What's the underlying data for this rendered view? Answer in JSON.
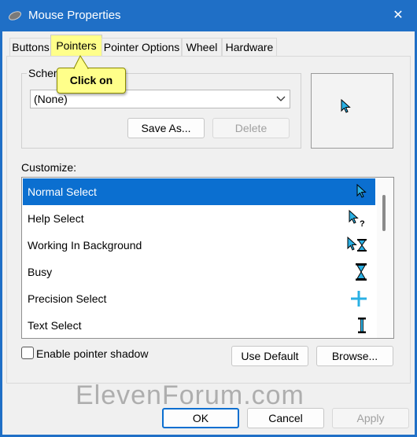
{
  "window": {
    "title": "Mouse Properties",
    "close_glyph": "✕"
  },
  "tabs": [
    {
      "label": "Buttons",
      "active": false
    },
    {
      "label": "Pointers",
      "active": true
    },
    {
      "label": "Pointer Options",
      "active": false
    },
    {
      "label": "Wheel",
      "active": false
    },
    {
      "label": "Hardware",
      "active": false
    }
  ],
  "callout": {
    "text": "Click on"
  },
  "scheme": {
    "label": "Schem",
    "dropdown_value": "(None)",
    "save_as_label": "Save As...",
    "delete_label": "Delete"
  },
  "customize": {
    "label": "Customize:",
    "items": [
      {
        "label": "Normal Select",
        "icon": "arrow-pointer-icon",
        "selected": true
      },
      {
        "label": "Help Select",
        "icon": "help-pointer-icon",
        "selected": false
      },
      {
        "label": "Working In Background",
        "icon": "working-pointer-icon",
        "selected": false
      },
      {
        "label": "Busy",
        "icon": "hourglass-icon",
        "selected": false
      },
      {
        "label": "Precision Select",
        "icon": "crosshair-icon",
        "selected": false
      },
      {
        "label": "Text Select",
        "icon": "text-beam-icon",
        "selected": false
      }
    ]
  },
  "options": {
    "enable_shadow_label": "Enable pointer shadow",
    "enable_shadow_checked": false,
    "use_default_label": "Use Default",
    "browse_label": "Browse..."
  },
  "footer": {
    "ok_label": "OK",
    "cancel_label": "Cancel",
    "apply_label": "Apply"
  },
  "watermark": {
    "text": "ElevenForum.com"
  },
  "colors": {
    "titlebar": "#1f6fc6",
    "selection": "#0b6fd0",
    "highlight": "#ffff8a",
    "pointer": "#2ab0e4"
  }
}
